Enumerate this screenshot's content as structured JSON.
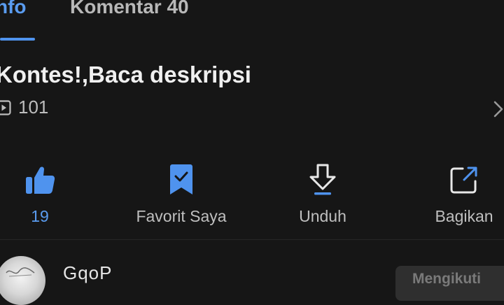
{
  "tabs": {
    "info_label": "nfo",
    "comments_label": "Komentar 40"
  },
  "content": {
    "title": "Kontes!,Baca deskripsi",
    "views": "101"
  },
  "actions": {
    "like_count": "19",
    "favorite_label": "Favorit Saya",
    "download_label": "Unduh",
    "share_label": "Bagikan"
  },
  "author": {
    "name": "GqoP",
    "follow_label": "Mengikuti"
  },
  "icons": {
    "like": "thumbs-up-icon",
    "favorite": "bookmark-check-icon",
    "download": "download-icon",
    "share": "share-icon",
    "views": "play-icon",
    "more": "chevron-right-icon"
  },
  "colors": {
    "accent": "#4f93ee",
    "background": "#161616"
  }
}
